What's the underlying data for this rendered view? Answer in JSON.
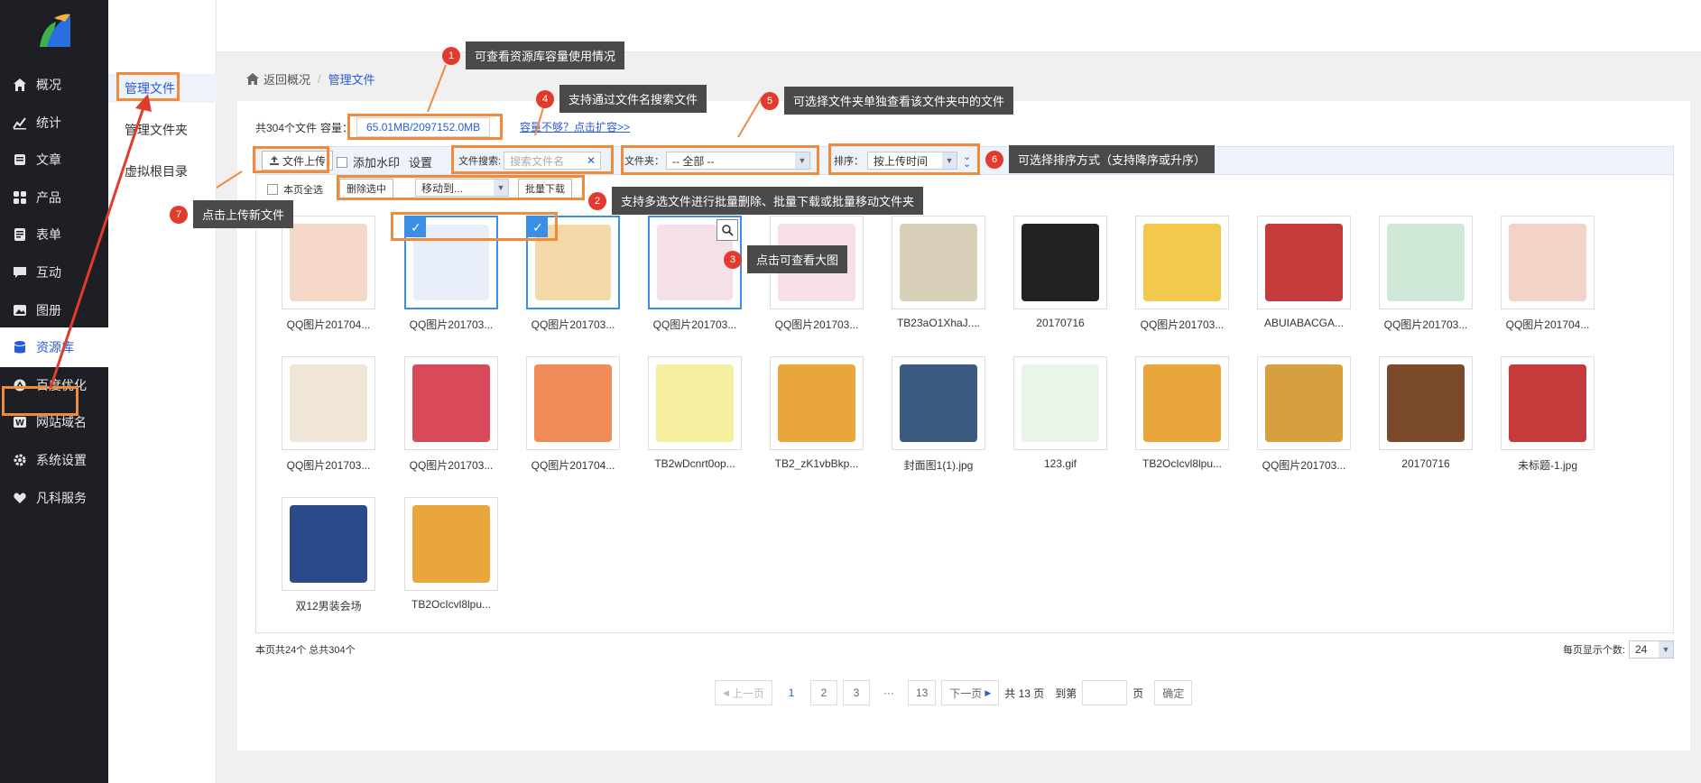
{
  "sidebar": {
    "items": [
      {
        "label": "概况",
        "icon": "home-icon"
      },
      {
        "label": "统计",
        "icon": "chart-icon"
      },
      {
        "label": "文章",
        "icon": "article-icon"
      },
      {
        "label": "产品",
        "icon": "grid-icon"
      },
      {
        "label": "表单",
        "icon": "form-icon"
      },
      {
        "label": "互动",
        "icon": "chat-icon"
      },
      {
        "label": "图册",
        "icon": "album-icon"
      },
      {
        "label": "资源库",
        "icon": "database-icon"
      },
      {
        "label": "百度优化",
        "icon": "seo-icon"
      },
      {
        "label": "网站域名",
        "icon": "domain-icon"
      },
      {
        "label": "系统设置",
        "icon": "gear-icon"
      },
      {
        "label": "凡科服务",
        "icon": "heart-icon"
      }
    ]
  },
  "subnav": {
    "items": [
      "管理文件",
      "管理文件夹",
      "虚拟根目录"
    ]
  },
  "breadcrumb": {
    "back": "返回概况",
    "current": "管理文件"
  },
  "capacity": {
    "count_text": "共304个文件",
    "label": "容量：",
    "value": "65.01MB/2097152.0MB",
    "expand_link": "容量不够？点击扩容>>"
  },
  "toolbar": {
    "upload": "文件上传",
    "watermark": "添加水印",
    "settings": "设置",
    "search_label": "文件搜索:",
    "search_placeholder": "搜索文件名",
    "folder_label": "文件夹：",
    "folder_value": "-- 全部 --",
    "sort_label": "排序：",
    "sort_value": "按上传时间"
  },
  "toolbar2": {
    "select_all": "本页全选",
    "delete": "删除选中",
    "move": "移动到...",
    "download": "批量下载"
  },
  "files": [
    {
      "name": "QQ图片201704...",
      "checked": false,
      "zoom": false
    },
    {
      "name": "QQ图片201703...",
      "checked": true,
      "zoom": false
    },
    {
      "name": "QQ图片201703...",
      "checked": true,
      "zoom": false
    },
    {
      "name": "QQ图片201703...",
      "checked": false,
      "zoom": true
    },
    {
      "name": "QQ图片201703...",
      "checked": false,
      "zoom": false
    },
    {
      "name": "TB23aO1XhaJ....",
      "checked": false,
      "zoom": false
    },
    {
      "name": "20170716",
      "checked": false,
      "zoom": false
    },
    {
      "name": "QQ图片201703...",
      "checked": false,
      "zoom": false
    },
    {
      "name": "ABUIABACGA...",
      "checked": false,
      "zoom": false
    },
    {
      "name": "QQ图片201703...",
      "checked": false,
      "zoom": false
    },
    {
      "name": "QQ图片201704...",
      "checked": false,
      "zoom": false
    },
    {
      "name": "QQ图片201703...",
      "checked": false,
      "zoom": false
    },
    {
      "name": "QQ图片201703...",
      "checked": false,
      "zoom": false
    },
    {
      "name": "QQ图片201704...",
      "checked": false,
      "zoom": false
    },
    {
      "name": "TB2wDcnrt0op...",
      "checked": false,
      "zoom": false
    },
    {
      "name": "TB2_zK1vbBkp...",
      "checked": false,
      "zoom": false
    },
    {
      "name": "封面图1(1).jpg",
      "checked": false,
      "zoom": false
    },
    {
      "name": "123.gif",
      "checked": false,
      "zoom": false
    },
    {
      "name": "TB2OcIcvl8lpu...",
      "checked": false,
      "zoom": false
    },
    {
      "name": "QQ图片201703...",
      "checked": false,
      "zoom": false
    },
    {
      "name": "20170716",
      "checked": false,
      "zoom": false
    },
    {
      "name": "未标题-1.jpg",
      "checked": false,
      "zoom": false
    },
    {
      "name": "双12男装会场",
      "checked": false,
      "zoom": false
    },
    {
      "name": "TB2OcIcvl8lpu...",
      "checked": false,
      "zoom": false
    }
  ],
  "thumb_colors": [
    "#f5d7c8",
    "#e8eef8",
    "#f3d9a8",
    "#f6e0e8",
    "#f7dfe6",
    "#d8cfb8",
    "#222222",
    "#f2c94c",
    "#c53a3a",
    "#cfe8d8",
    "#f3d2c8",
    "#f0e6d8",
    "#d84a5a",
    "#f08c5a",
    "#f4f0a0",
    "#e9a63b",
    "#3a5a80",
    "#e8f5e8",
    "#e9a63b",
    "#d6a040",
    "#7a4a2a",
    "#c53a3a",
    "#2a4a8a",
    "#e9a63b"
  ],
  "footer": {
    "info": "本页共24个 总共304个",
    "per_page_label": "每页显示个数:",
    "per_page_value": "24"
  },
  "pager": {
    "prev": "上一页",
    "pages": [
      "1",
      "2",
      "3",
      "···",
      "13"
    ],
    "next": "下一页",
    "total": "共 13 页",
    "goto_label": "到第",
    "goto_unit": "页",
    "confirm": "确定"
  },
  "callouts": [
    {
      "num": "1",
      "text": "可查看资源库容量使用情况"
    },
    {
      "num": "2",
      "text": "支持多选文件进行批量删除、批量下载或批量移动文件夹"
    },
    {
      "num": "3",
      "text": "点击可查看大图"
    },
    {
      "num": "4",
      "text": "支持通过文件名搜索文件"
    },
    {
      "num": "5",
      "text": "可选择文件夹单独查看该文件夹中的文件"
    },
    {
      "num": "6",
      "text": "可选择排序方式（支持降序或升序）"
    },
    {
      "num": "7",
      "text": "点击上传新文件"
    }
  ]
}
